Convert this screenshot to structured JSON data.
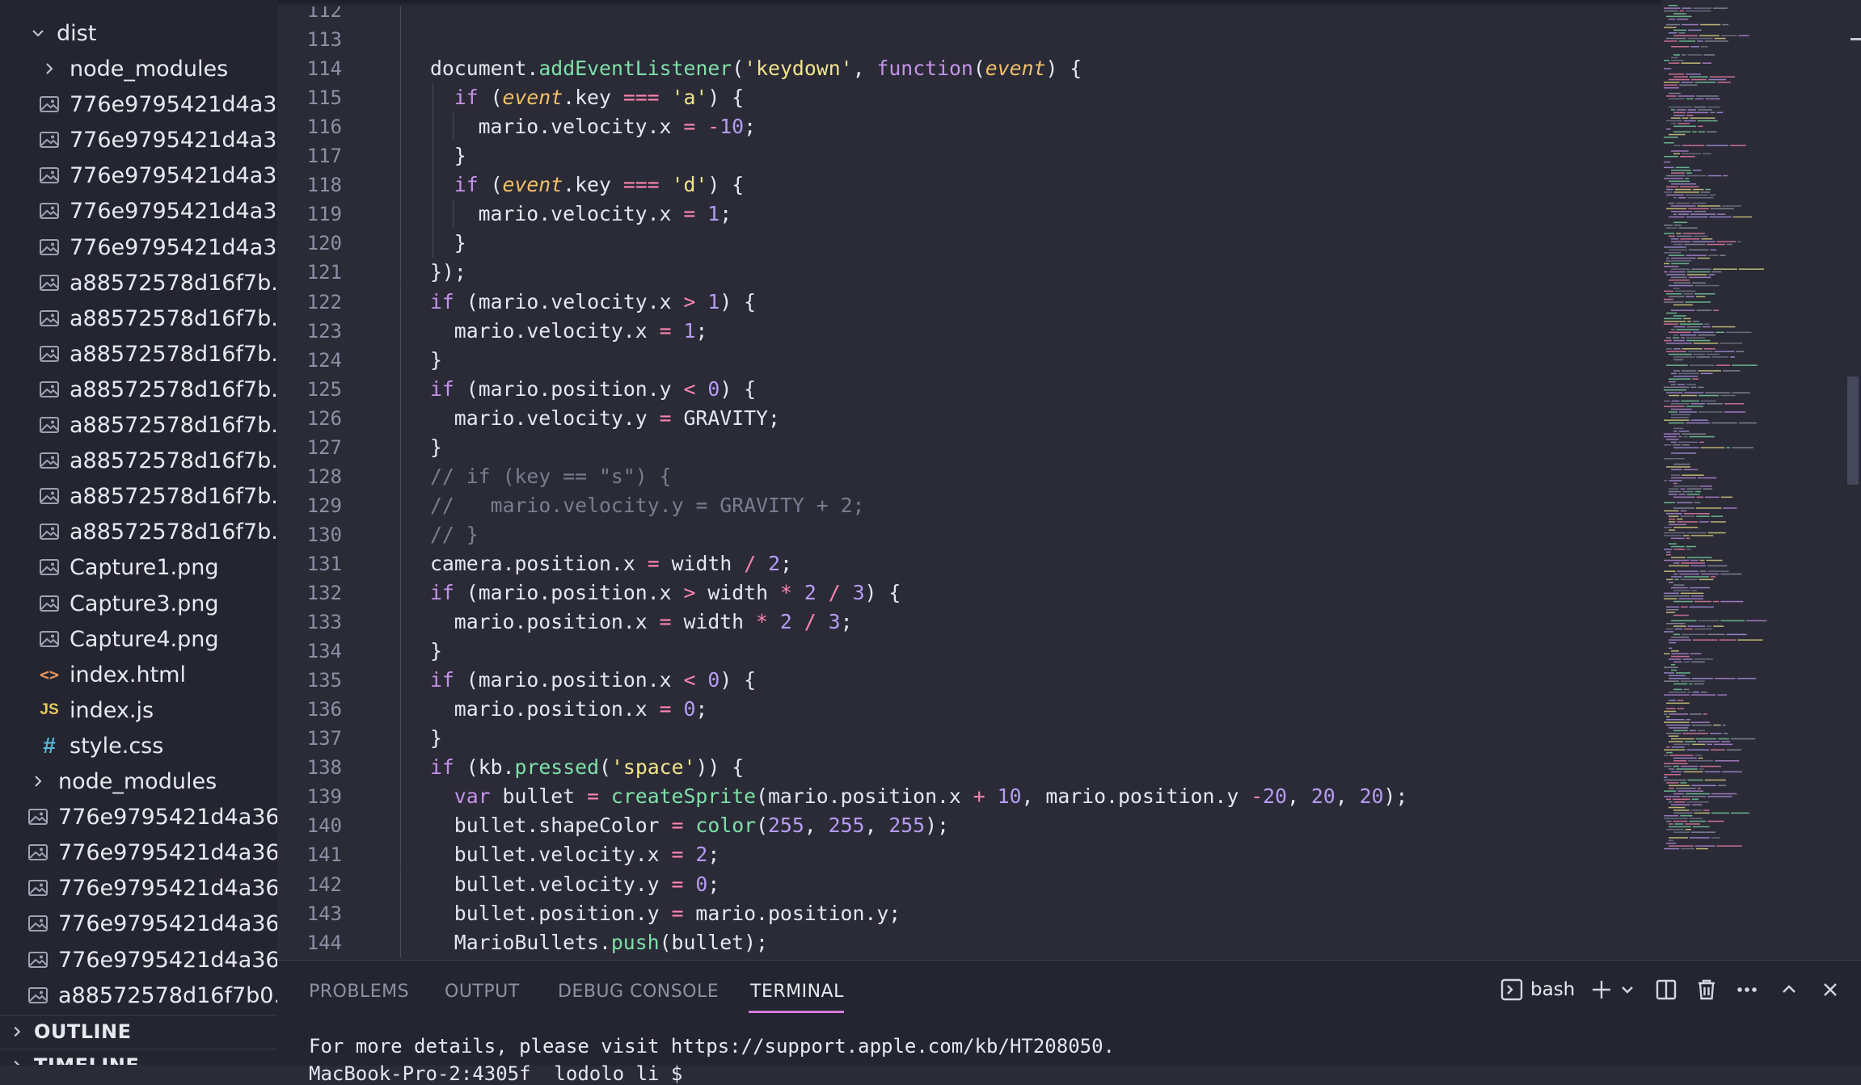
{
  "explorer": {
    "dist_folder": "dist",
    "items": [
      {
        "label": "node_modules",
        "icon": "chevron-right-icon",
        "kind": "folder"
      },
      {
        "label": "776e9795421d4a3...",
        "icon": "image-file-icon"
      },
      {
        "label": "776e9795421d4a3...",
        "icon": "image-file-icon"
      },
      {
        "label": "776e9795421d4a3...",
        "icon": "image-file-icon"
      },
      {
        "label": "776e9795421d4a3...",
        "icon": "image-file-icon"
      },
      {
        "label": "776e9795421d4a3...",
        "icon": "image-file-icon"
      },
      {
        "label": "a88572578d16f7b...",
        "icon": "image-file-icon"
      },
      {
        "label": "a88572578d16f7b...",
        "icon": "image-file-icon"
      },
      {
        "label": "a88572578d16f7b...",
        "icon": "image-file-icon"
      },
      {
        "label": "a88572578d16f7b...",
        "icon": "image-file-icon"
      },
      {
        "label": "a88572578d16f7b...",
        "icon": "image-file-icon"
      },
      {
        "label": "a88572578d16f7b...",
        "icon": "image-file-icon"
      },
      {
        "label": "a88572578d16f7b...",
        "icon": "image-file-icon"
      },
      {
        "label": "a88572578d16f7b...",
        "icon": "image-file-icon"
      },
      {
        "label": "Capture1.png",
        "icon": "image-file-icon"
      },
      {
        "label": "Capture3.png",
        "icon": "image-file-icon"
      },
      {
        "label": "Capture4.png",
        "icon": "image-file-icon"
      },
      {
        "label": "index.html",
        "icon": "html-file-icon"
      },
      {
        "label": "index.js",
        "icon": "js-file-icon"
      },
      {
        "label": "style.css",
        "icon": "css-file-icon"
      }
    ],
    "root_items": [
      {
        "label": "node_modules",
        "icon": "chevron-right-icon",
        "kind": "folder"
      },
      {
        "label": "776e9795421d4a36...",
        "icon": "image-file-icon"
      },
      {
        "label": "776e9795421d4a36...",
        "icon": "image-file-icon"
      },
      {
        "label": "776e9795421d4a36...",
        "icon": "image-file-icon"
      },
      {
        "label": "776e9795421d4a36...",
        "icon": "image-file-icon"
      },
      {
        "label": "776e9795421d4a36...",
        "icon": "image-file-icon"
      },
      {
        "label": "a88572578d16f7b0...",
        "icon": "image-file-icon"
      }
    ],
    "icon_text": {
      "html": "<>",
      "js": "JS",
      "css": "#"
    },
    "outline_label": "OUTLINE",
    "timeline_label": "TIMELINE"
  },
  "editor": {
    "line_numbers": [
      "112",
      "113",
      "114",
      "115",
      "116",
      "117",
      "118",
      "119",
      "120",
      "121",
      "122",
      "123",
      "124",
      "125",
      "126",
      "127",
      "128",
      "129",
      "130",
      "131",
      "132",
      "133",
      "134",
      "135",
      "136",
      "137",
      "138",
      "139",
      "140",
      "141",
      "142",
      "143",
      "144"
    ],
    "lines": [
      [],
      [],
      [
        [
          "pn",
          "document."
        ],
        [
          "fn",
          "addEventListener"
        ],
        [
          "pn",
          "("
        ],
        [
          "str",
          "'keydown'"
        ],
        [
          "pn",
          ", "
        ],
        [
          "kw",
          "function"
        ],
        [
          "pn",
          "("
        ],
        [
          "par",
          "event"
        ],
        [
          "pn",
          ") {"
        ]
      ],
      [
        [
          "kw",
          "if"
        ],
        [
          "pn",
          " ("
        ],
        [
          "par",
          "event"
        ],
        [
          "pn",
          ".key "
        ],
        [
          "op",
          "==="
        ],
        [
          "pn",
          " "
        ],
        [
          "str",
          "'a'"
        ],
        [
          "pn",
          ") {"
        ]
      ],
      [
        [
          "pn",
          "mario.velocity.x "
        ],
        [
          "op",
          "="
        ],
        [
          "pn",
          " "
        ],
        [
          "op",
          "-"
        ],
        [
          "num",
          "10"
        ],
        [
          "pn",
          ";"
        ]
      ],
      [
        [
          "pn",
          "}"
        ]
      ],
      [
        [
          "kw",
          "if"
        ],
        [
          "pn",
          " ("
        ],
        [
          "par",
          "event"
        ],
        [
          "pn",
          ".key "
        ],
        [
          "op",
          "==="
        ],
        [
          "pn",
          " "
        ],
        [
          "str",
          "'d'"
        ],
        [
          "pn",
          ") {"
        ]
      ],
      [
        [
          "pn",
          "mario.velocity.x "
        ],
        [
          "op",
          "="
        ],
        [
          "pn",
          " "
        ],
        [
          "num",
          "1"
        ],
        [
          "pn",
          ";"
        ]
      ],
      [
        [
          "pn",
          "}"
        ]
      ],
      [
        [
          "pn",
          "});"
        ]
      ],
      [
        [
          "kw",
          "if"
        ],
        [
          "pn",
          " (mario.velocity.x "
        ],
        [
          "op",
          ">"
        ],
        [
          "pn",
          " "
        ],
        [
          "num",
          "1"
        ],
        [
          "pn",
          ") {"
        ]
      ],
      [
        [
          "pn",
          "mario.velocity.x "
        ],
        [
          "op",
          "="
        ],
        [
          "pn",
          " "
        ],
        [
          "num",
          "1"
        ],
        [
          "pn",
          ";"
        ]
      ],
      [
        [
          "pn",
          "}"
        ]
      ],
      [
        [
          "kw",
          "if"
        ],
        [
          "pn",
          " (mario.position.y "
        ],
        [
          "op",
          "<"
        ],
        [
          "pn",
          " "
        ],
        [
          "num",
          "0"
        ],
        [
          "pn",
          ") {"
        ]
      ],
      [
        [
          "pn",
          "mario.velocity.y "
        ],
        [
          "op",
          "="
        ],
        [
          "pn",
          " GRAVITY;"
        ]
      ],
      [
        [
          "pn",
          "}"
        ]
      ],
      [
        [
          "cm",
          "// if (key == \"s\") {"
        ]
      ],
      [
        [
          "cm",
          "//   mario.velocity.y = GRAVITY + 2;"
        ]
      ],
      [
        [
          "cm",
          "// }"
        ]
      ],
      [
        [
          "pn",
          "camera.position.x "
        ],
        [
          "op",
          "="
        ],
        [
          "pn",
          " width "
        ],
        [
          "op",
          "/"
        ],
        [
          "pn",
          " "
        ],
        [
          "num",
          "2"
        ],
        [
          "pn",
          ";"
        ]
      ],
      [
        [
          "kw",
          "if"
        ],
        [
          "pn",
          " (mario.position.x "
        ],
        [
          "op",
          ">"
        ],
        [
          "pn",
          " width "
        ],
        [
          "op",
          "*"
        ],
        [
          "pn",
          " "
        ],
        [
          "num",
          "2"
        ],
        [
          "pn",
          " "
        ],
        [
          "op",
          "/"
        ],
        [
          "pn",
          " "
        ],
        [
          "num",
          "3"
        ],
        [
          "pn",
          ") {"
        ]
      ],
      [
        [
          "pn",
          "mario.position.x "
        ],
        [
          "op",
          "="
        ],
        [
          "pn",
          " width "
        ],
        [
          "op",
          "*"
        ],
        [
          "pn",
          " "
        ],
        [
          "num",
          "2"
        ],
        [
          "pn",
          " "
        ],
        [
          "op",
          "/"
        ],
        [
          "pn",
          " "
        ],
        [
          "num",
          "3"
        ],
        [
          "pn",
          ";"
        ]
      ],
      [
        [
          "pn",
          "}"
        ]
      ],
      [
        [
          "kw",
          "if"
        ],
        [
          "pn",
          " (mario.position.x "
        ],
        [
          "op",
          "<"
        ],
        [
          "pn",
          " "
        ],
        [
          "num",
          "0"
        ],
        [
          "pn",
          ") {"
        ]
      ],
      [
        [
          "pn",
          "mario.position.x "
        ],
        [
          "op",
          "="
        ],
        [
          "pn",
          " "
        ],
        [
          "num",
          "0"
        ],
        [
          "pn",
          ";"
        ]
      ],
      [
        [
          "pn",
          "}"
        ]
      ],
      [
        [
          "kw",
          "if"
        ],
        [
          "pn",
          " (kb."
        ],
        [
          "fn",
          "pressed"
        ],
        [
          "pn",
          "("
        ],
        [
          "str",
          "'space'"
        ],
        [
          "pn",
          ")) {"
        ]
      ],
      [
        [
          "kw",
          "var"
        ],
        [
          "pn",
          " bullet "
        ],
        [
          "op",
          "="
        ],
        [
          "pn",
          " "
        ],
        [
          "fn",
          "createSprite"
        ],
        [
          "pn",
          "(mario.position.x "
        ],
        [
          "op",
          "+"
        ],
        [
          "pn",
          " "
        ],
        [
          "num",
          "10"
        ],
        [
          "pn",
          ", mario.position.y "
        ],
        [
          "op",
          "-"
        ],
        [
          "num",
          "20"
        ],
        [
          "pn",
          ", "
        ],
        [
          "num",
          "20"
        ],
        [
          "pn",
          ", "
        ],
        [
          "num",
          "20"
        ],
        [
          "pn",
          ");"
        ]
      ],
      [
        [
          "pn",
          "bullet.shapeColor "
        ],
        [
          "op",
          "="
        ],
        [
          "pn",
          " "
        ],
        [
          "fn",
          "color"
        ],
        [
          "pn",
          "("
        ],
        [
          "num",
          "255"
        ],
        [
          "pn",
          ", "
        ],
        [
          "num",
          "255"
        ],
        [
          "pn",
          ", "
        ],
        [
          "num",
          "255"
        ],
        [
          "pn",
          ");"
        ]
      ],
      [
        [
          "pn",
          "bullet.velocity.x "
        ],
        [
          "op",
          "="
        ],
        [
          "pn",
          " "
        ],
        [
          "num",
          "2"
        ],
        [
          "pn",
          ";"
        ]
      ],
      [
        [
          "pn",
          "bullet.velocity.y "
        ],
        [
          "op",
          "="
        ],
        [
          "pn",
          " "
        ],
        [
          "num",
          "0"
        ],
        [
          "pn",
          ";"
        ]
      ],
      [
        [
          "pn",
          "bullet.position.y "
        ],
        [
          "op",
          "="
        ],
        [
          "pn",
          " mario.position.y;"
        ]
      ],
      [
        [
          "pn",
          "MarioBullets."
        ],
        [
          "fn",
          "push"
        ],
        [
          "pn",
          "(bullet);"
        ]
      ]
    ],
    "indent_levels": [
      0,
      0,
      0,
      1,
      2,
      1,
      1,
      2,
      1,
      0,
      0,
      1,
      0,
      0,
      1,
      0,
      0,
      0,
      0,
      0,
      0,
      1,
      0,
      0,
      1,
      0,
      0,
      1,
      1,
      1,
      1,
      1,
      1
    ]
  },
  "panel": {
    "tabs": [
      "PROBLEMS",
      "OUTPUT",
      "DEBUG CONSOLE",
      "TERMINAL"
    ],
    "active_tab": "TERMINAL",
    "shell_label": "bash",
    "terminal_lines": [
      "For more details, please visit https://support.apple.com/kb/HT208050.",
      "MacBook-Pro-2:4305f  lodolo li $"
    ],
    "actions": [
      "terminal-icon",
      "plus-icon",
      "chevron-down-icon",
      "split-icon",
      "trash-icon",
      "more-icon",
      "chevron-up-icon",
      "close-icon"
    ]
  },
  "colors": {
    "keyword": "#c792ea",
    "function": "#7fe0a8",
    "string": "#f1e48a",
    "number": "#b79cf2",
    "operator": "#ff86b0",
    "parameter": "#f3c069",
    "comment": "#7a7d8f",
    "active_tab_underline": "#d67ad8"
  }
}
